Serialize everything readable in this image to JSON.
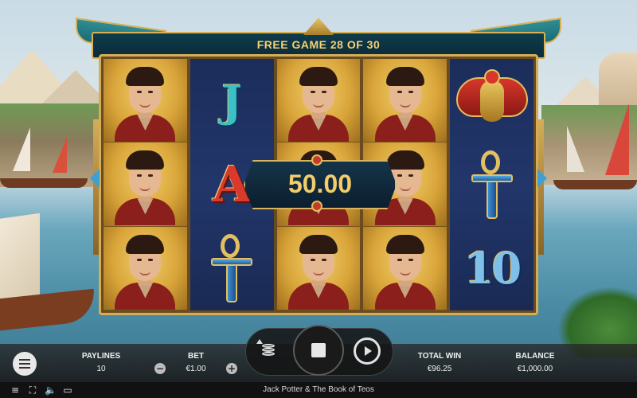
{
  "header": {
    "title": "FREE GAME 28 OF 30"
  },
  "reels": [
    [
      "portrait",
      "portrait",
      "portrait"
    ],
    [
      "J",
      "A",
      "ankh"
    ],
    [
      "portrait",
      "portrait",
      "portrait"
    ],
    [
      "portrait",
      "portrait",
      "portrait"
    ],
    [
      "scarab",
      "ankh",
      "10"
    ]
  ],
  "win_display": {
    "amount": "50.00"
  },
  "controls": {
    "paylines_label": "PAYLINES",
    "paylines_value": "10",
    "bet_label": "BET",
    "bet_value": "€1.00",
    "bet_decrease_symbol": "−",
    "bet_increase_symbol": "+",
    "total_win_label": "TOTAL WIN",
    "total_win_value": "€96.25",
    "balance_label": "BALANCE",
    "balance_value": "€1,000.00"
  },
  "status_bar": {
    "game_title": "Jack Potter & The Book of Teos",
    "icons": [
      "menu-icon",
      "fullscreen-icon",
      "sound-icon",
      "paytable-icon"
    ]
  },
  "colors": {
    "accent_gold": "#d7b153",
    "win_text": "#f4cd6b",
    "header_text": "#f6d274"
  }
}
